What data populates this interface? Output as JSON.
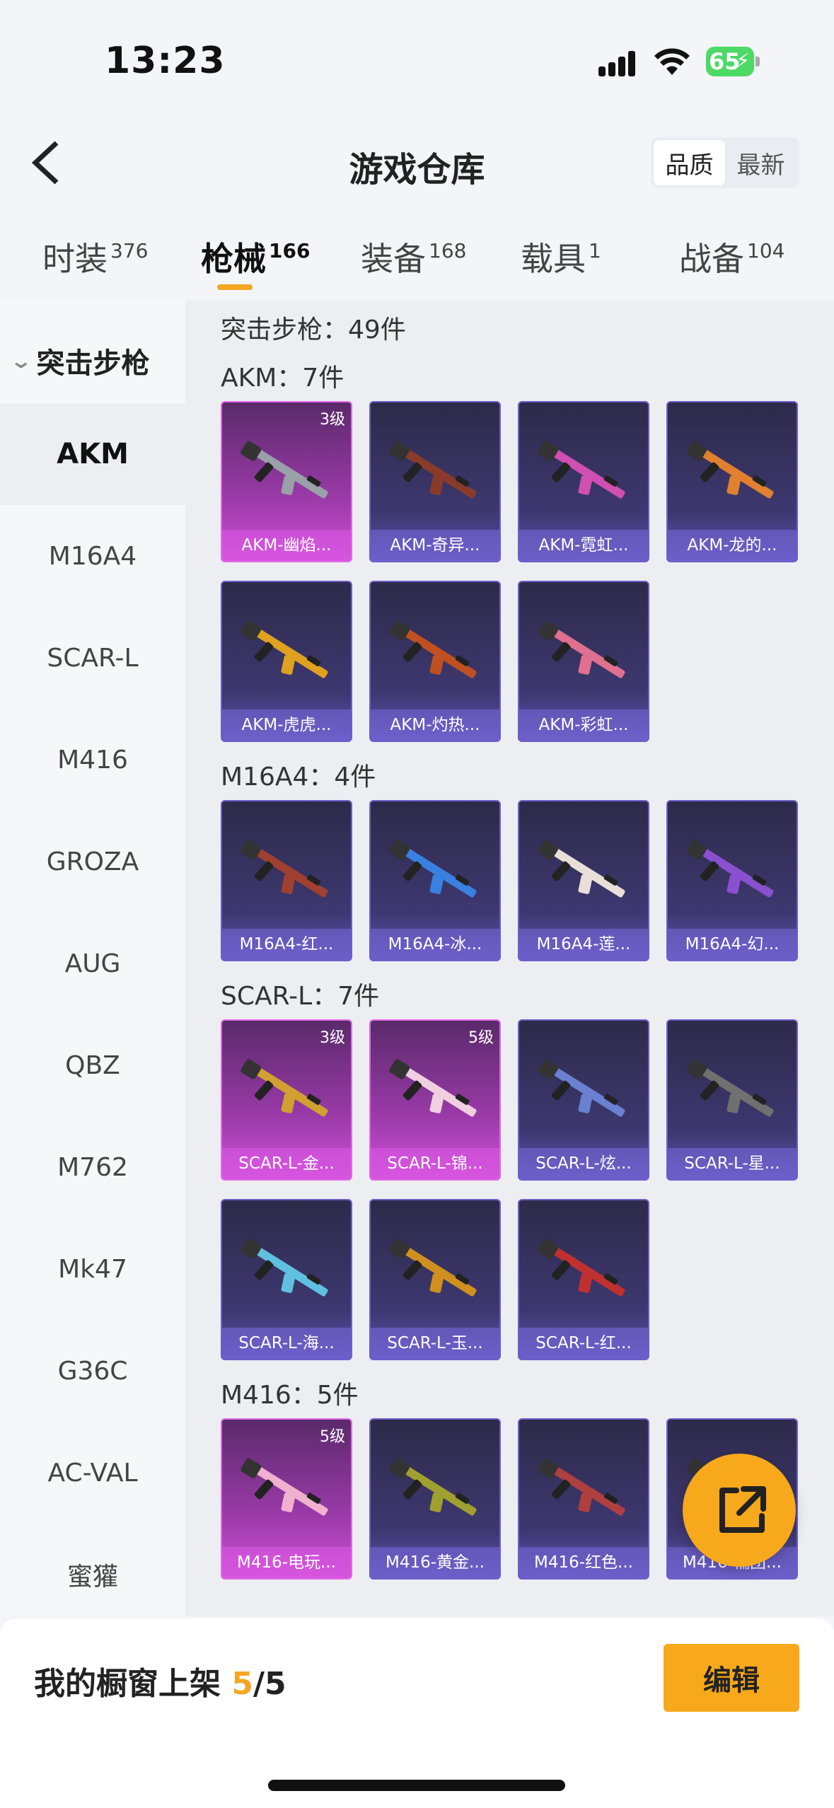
{
  "status_bar": {
    "time": "13:23",
    "battery": "65"
  },
  "header": {
    "title": "游戏仓库",
    "sort_options": [
      "品质",
      "最新"
    ],
    "sort_active": "品质"
  },
  "category_tabs": [
    {
      "label": "时装",
      "count": "376"
    },
    {
      "label": "枪械",
      "count": "166",
      "active": true
    },
    {
      "label": "装备",
      "count": "168"
    },
    {
      "label": "载具",
      "count": "1"
    },
    {
      "label": "战备",
      "count": "104"
    }
  ],
  "sidebar": {
    "group": "突击步枪",
    "items": [
      "AKM",
      "M16A4",
      "SCAR-L",
      "M416",
      "GROZA",
      "AUG",
      "QBZ",
      "M762",
      "Mk47",
      "G36C",
      "AC-VAL",
      "蜜獾"
    ],
    "active": "AKM"
  },
  "content": {
    "total": "突击步枪：49件",
    "sections": [
      {
        "title": "AKM：7件",
        "items": [
          {
            "name": "AKM-幽焰...",
            "level": "3级",
            "rarity": "pink",
            "color": "#9aa0a8"
          },
          {
            "name": "AKM-奇异...",
            "rarity": "purple",
            "color": "#8a3a2a"
          },
          {
            "name": "AKM-霓虹...",
            "rarity": "purple",
            "color": "#d04fb0"
          },
          {
            "name": "AKM-龙的...",
            "rarity": "purple",
            "color": "#e08030"
          },
          {
            "name": "AKM-虎虎...",
            "rarity": "purple",
            "color": "#e0a020"
          },
          {
            "name": "AKM-灼热...",
            "rarity": "purple",
            "color": "#c05020"
          },
          {
            "name": "AKM-彩虹...",
            "rarity": "purple",
            "color": "#e07090"
          }
        ]
      },
      {
        "title": "M16A4：4件",
        "items": [
          {
            "name": "M16A4-红...",
            "rarity": "purple",
            "color": "#a04030"
          },
          {
            "name": "M16A4-冰...",
            "rarity": "purple",
            "color": "#3a80e0"
          },
          {
            "name": "M16A4-莲...",
            "rarity": "purple",
            "color": "#e8e0d8"
          },
          {
            "name": "M16A4-幻...",
            "rarity": "purple",
            "color": "#8a50d0"
          }
        ]
      },
      {
        "title": "SCAR-L：7件",
        "items": [
          {
            "name": "SCAR-L-金...",
            "level": "3级",
            "rarity": "pink",
            "color": "#d0a030"
          },
          {
            "name": "SCAR-L-锦...",
            "level": "5级",
            "rarity": "pink",
            "color": "#f0d0e0"
          },
          {
            "name": "SCAR-L-炫...",
            "rarity": "purple",
            "color": "#6a80d0"
          },
          {
            "name": "SCAR-L-星...",
            "rarity": "purple",
            "color": "#707070"
          },
          {
            "name": "SCAR-L-海...",
            "rarity": "purple",
            "color": "#60c0e0"
          },
          {
            "name": "SCAR-L-玉...",
            "rarity": "purple",
            "color": "#d09020"
          },
          {
            "name": "SCAR-L-红...",
            "rarity": "purple",
            "color": "#c03030"
          }
        ]
      },
      {
        "title": "M416：5件",
        "items": [
          {
            "name": "M416-电玩...",
            "level": "5级",
            "rarity": "pink",
            "color": "#f0b0d0"
          },
          {
            "name": "M416-黄金...",
            "rarity": "purple",
            "color": "#a0a030"
          },
          {
            "name": "M416-红色...",
            "rarity": "purple",
            "color": "#b04040"
          },
          {
            "name": "M416-糯团...",
            "rarity": "purple",
            "color": "#707070"
          }
        ]
      }
    ]
  },
  "bottom": {
    "label": "我的橱窗上架 ",
    "count": "5",
    "total": "/5",
    "edit_label": "编辑"
  },
  "icons": {
    "back": "chevron-left-icon",
    "share": "share-external-icon"
  }
}
